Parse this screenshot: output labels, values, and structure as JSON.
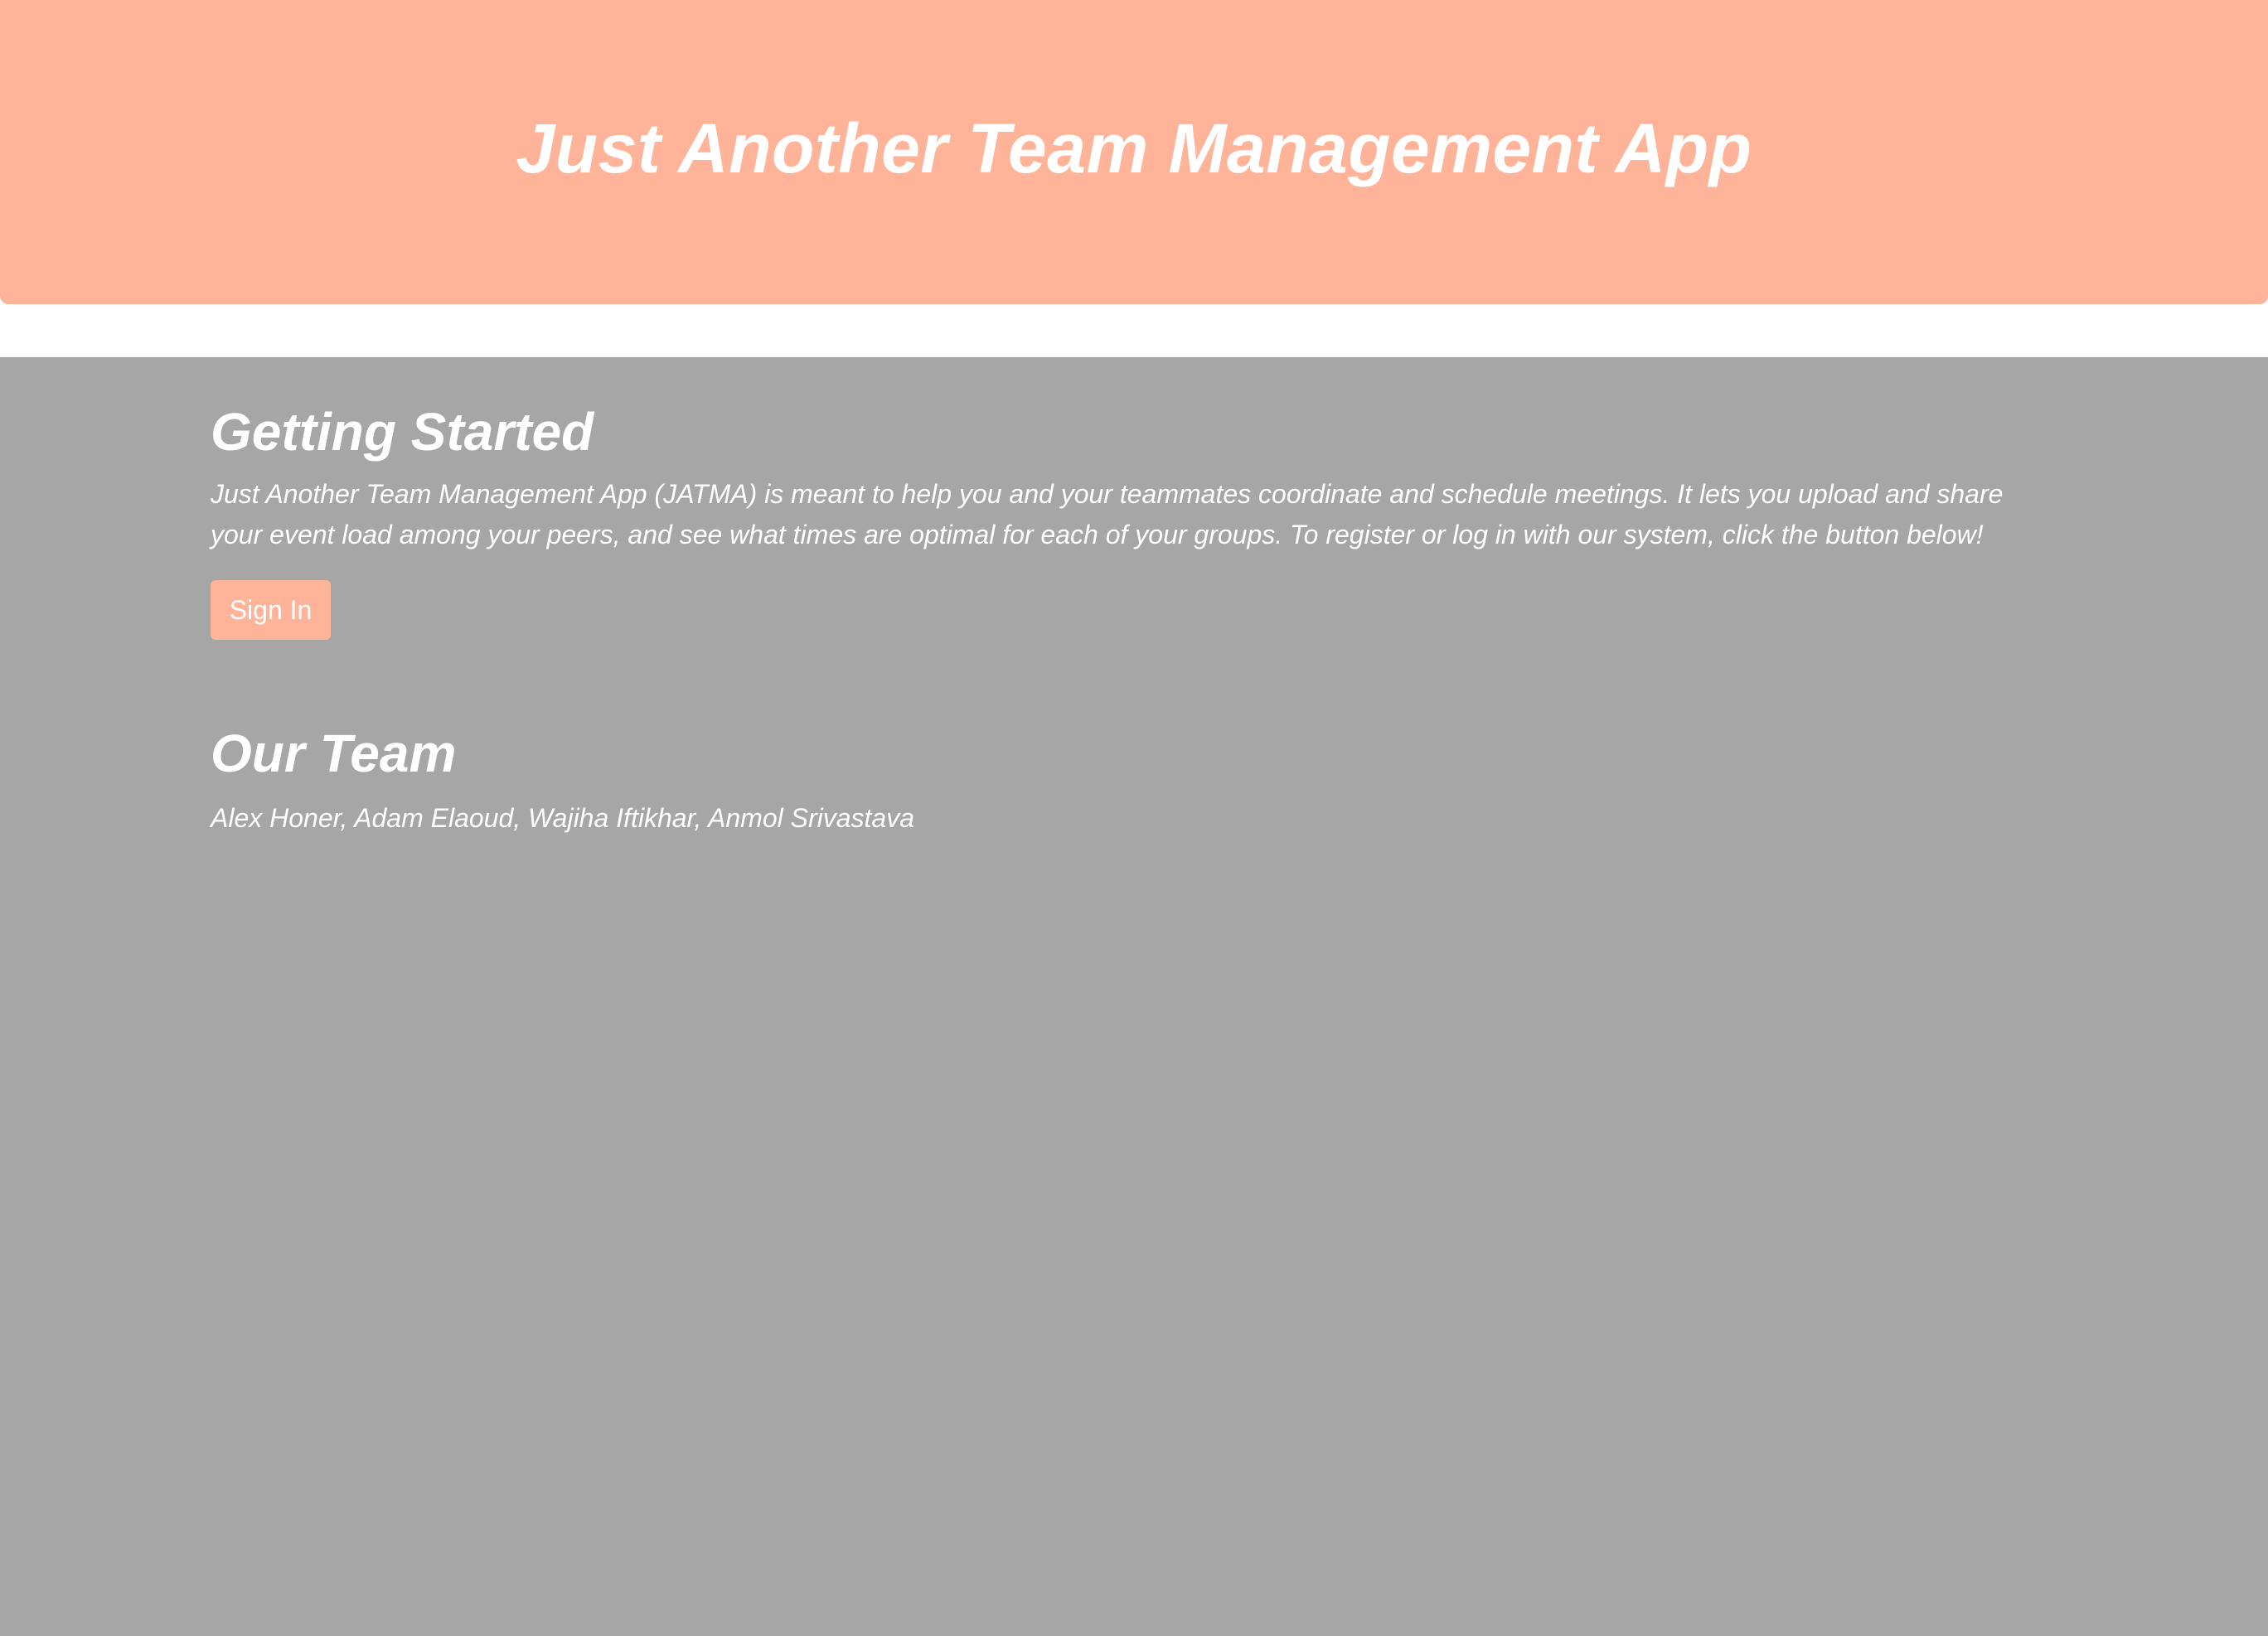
{
  "header": {
    "title": "Just Another Team Management App"
  },
  "getting_started": {
    "title": "Getting Started",
    "text": "Just Another Team Management App (JATMA) is meant to help you and your teammates coordinate and schedule meetings. It lets you upload and share your event load among your peers, and see what times are optimal for each of your groups. To register or log in with our system, click the button below!",
    "button_label": "Sign In"
  },
  "our_team": {
    "title": "Our Team",
    "members": "Alex Honer, Adam Elaoud, Wajiha Iftikhar, Anmol Srivastava"
  },
  "colors": {
    "accent": "#ffb499",
    "background": "#a6a6a6",
    "text": "#ffffff"
  }
}
